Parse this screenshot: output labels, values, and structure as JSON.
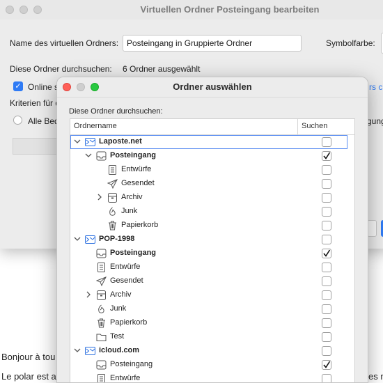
{
  "background_texts": [
    "Bonjour à tou",
    "Le polar est a",
    "es n"
  ],
  "back_window": {
    "title": "Virtuellen Ordner Posteingang bearbeiten",
    "name_label": "Name des virtuellen Ordners:",
    "name_value": "Posteingang in Gruppierte Ordner",
    "symbol_color_label": "Symbolfarbe:",
    "search_folders_label": "Diese Ordner durchsuchen:",
    "search_folders_value": "6 Ordner ausgewählt",
    "online_label": "Online s",
    "online_right": "rs c",
    "criteria_label": "Kriterien für d",
    "all_label": "Alle Bed",
    "all_right": "gung"
  },
  "dialog": {
    "title": "Ordner auswählen",
    "label": "Diese Ordner durchsuchen:",
    "columns": {
      "name": "Ordnername",
      "search": "Suchen"
    },
    "rows": [
      {
        "label": "Laposte.net",
        "icon": "account-icon",
        "disclosure": "open",
        "bold": true,
        "checked": false,
        "selected": true
      },
      {
        "label": "Posteingang",
        "icon": "inbox-icon",
        "disclosure": "open",
        "bold": true,
        "checked": true
      },
      {
        "label": "Entwürfe",
        "icon": "drafts-icon",
        "disclosure": "",
        "bold": false,
        "checked": false
      },
      {
        "label": "Gesendet",
        "icon": "sent-icon",
        "disclosure": "",
        "bold": false,
        "checked": false
      },
      {
        "label": "Archiv",
        "icon": "archive-icon",
        "disclosure": "closed",
        "bold": false,
        "checked": false
      },
      {
        "label": "Junk",
        "icon": "junk-icon",
        "disclosure": "",
        "bold": false,
        "checked": false
      },
      {
        "label": "Papierkorb",
        "icon": "trash-icon",
        "disclosure": "",
        "bold": false,
        "checked": false
      },
      {
        "label": "POP-1998",
        "icon": "account-icon",
        "disclosure": "open",
        "bold": true,
        "checked": false
      },
      {
        "label": "Posteingang",
        "icon": "inbox-icon",
        "disclosure": "",
        "bold": true,
        "checked": true
      },
      {
        "label": "Entwürfe",
        "icon": "drafts-icon",
        "disclosure": "",
        "bold": false,
        "checked": false
      },
      {
        "label": "Gesendet",
        "icon": "sent-icon",
        "disclosure": "",
        "bold": false,
        "checked": false
      },
      {
        "label": "Archiv",
        "icon": "archive-icon",
        "disclosure": "closed",
        "bold": false,
        "checked": false
      },
      {
        "label": "Junk",
        "icon": "junk-icon",
        "disclosure": "",
        "bold": false,
        "checked": false
      },
      {
        "label": "Papierkorb",
        "icon": "trash-icon",
        "disclosure": "",
        "bold": false,
        "checked": false
      },
      {
        "label": "Test",
        "icon": "folder-icon",
        "disclosure": "",
        "bold": false,
        "checked": false
      },
      {
        "label": "icloud.com",
        "icon": "account-icon",
        "disclosure": "open",
        "bold": true,
        "checked": false
      },
      {
        "label": "Posteingang",
        "icon": "inbox-icon",
        "disclosure": "",
        "bold": false,
        "checked": true
      },
      {
        "label": "Entwürfe",
        "icon": "drafts-icon",
        "disclosure": "",
        "bold": false,
        "checked": false
      }
    ]
  },
  "colors": {
    "accent": "#2f7bf5",
    "close": "#fe5f57",
    "zoom": "#28c840"
  }
}
